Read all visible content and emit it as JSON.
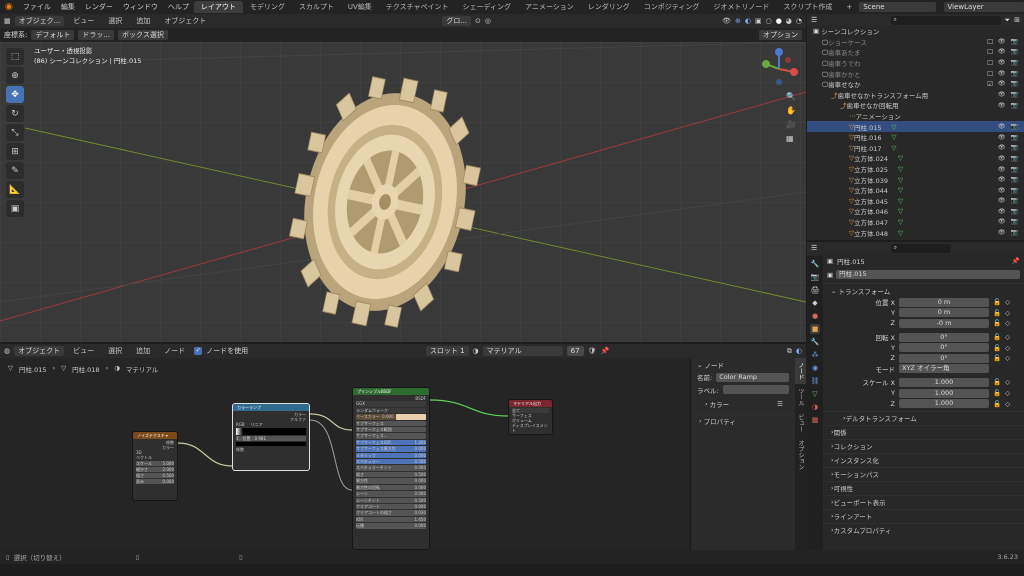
{
  "menubar": {
    "items": [
      "ファイル",
      "編集",
      "レンダー",
      "ウィンドウ",
      "ヘルプ"
    ],
    "workspaces": [
      "レイアウト",
      "モデリング",
      "スカルプト",
      "UV編集",
      "テクスチャペイント",
      "シェーディング",
      "アニメーション",
      "レンダリング",
      "コンポジティング",
      "ジオメトリノード",
      "スクリプト作成"
    ],
    "add_tab": "+",
    "scene": "Scene",
    "view_layer": "ViewLayer"
  },
  "viewport": {
    "mode": "オブジェク...",
    "menus": [
      "ビュー",
      "選択",
      "追加",
      "オブジェクト"
    ],
    "orientation_label": "座標系:",
    "orientation": "デフォルト",
    "drag": "ドラッ...",
    "select_mode": "ボックス選択",
    "pivot": "グロ...",
    "options": "オプション",
    "overlay_title": "ユーザー・透視投影",
    "overlay_sub": "(86) シーンコレクション | 円柱.015"
  },
  "node_editor": {
    "mode": "オブジェクト",
    "menus": [
      "ビュー",
      "選択",
      "追加",
      "ノード"
    ],
    "use_nodes": "ノードを使用",
    "slot": "スロット 1",
    "material": "マテリアル",
    "users": "67",
    "breadcrumb": [
      "円柱.015",
      "円柱.018",
      "マテリアル"
    ],
    "nodes": {
      "noise": {
        "title": "ノイズテクスチャ",
        "rows": [
          "係数",
          "カラー",
          "",
          "3D",
          "",
          "ベクトル",
          "スケール",
          "細かさ",
          "粗さ",
          "歪み"
        ],
        "values": [
          "5.000",
          "2.000",
          "0.500",
          "0.000"
        ]
      },
      "ramp": {
        "title": "カラーランプ",
        "out": [
          "カラー",
          "アルファ"
        ],
        "mode": "RGB",
        "interp": "リニア",
        "pos_index": "1",
        "pos_label": "位置",
        "pos_value": "0.981",
        "in": "係数"
      },
      "bsdf": {
        "title": "プリンシプルBSDF",
        "out": "BSDF",
        "dist": "GGX",
        "sss": "ランダムウォーク",
        "rows": [
          "ベースカラー",
          "サブサーフェス",
          "サブサーフェス範囲",
          "サブサーフェス...",
          "サブサーフェスIOR",
          "サブサーフェス異方性",
          "メタリック",
          "スペキュラー",
          "スペキュラーチント",
          "粗さ",
          "異方性",
          "異方性の回転",
          "シーン",
          "シーンチント",
          "クリアコート",
          "クリアコートの粗さ",
          "IOR",
          "伝播"
        ],
        "values": [
          "0.000",
          "",
          "",
          "",
          "1.400",
          "0.000",
          "0.000",
          "0.500",
          "0.000",
          "0.500",
          "0.000",
          "0.000",
          "0.000",
          "0.500",
          "0.000",
          "0.030",
          "1.450",
          "0.000"
        ]
      },
      "output": {
        "title": "マテリアル出力",
        "target": "全て",
        "rows": [
          "サーフェス",
          "ボリューム",
          "ディスプレイスメント"
        ]
      }
    }
  },
  "node_panel": {
    "section": "ノード",
    "name_label": "名前:",
    "name": "Color Ramp",
    "label_label": "ラベル:",
    "color": "カラー",
    "properties": "プロパティ",
    "tabs": [
      "ノード",
      "ツール",
      "ビュー",
      "オプション"
    ]
  },
  "outliner": {
    "root": "シーンコレクション",
    "items": [
      {
        "label": "ショーケース",
        "indent": 1
      },
      {
        "label": "歯車あたま",
        "indent": 1
      },
      {
        "label": "歯車うでわ",
        "indent": 1
      },
      {
        "label": "歯車かかと",
        "indent": 1
      },
      {
        "label": "歯車せなか",
        "indent": 1
      },
      {
        "label": "歯車せなかトランスフォーム用",
        "indent": 2
      },
      {
        "label": "歯車せなか回転用",
        "indent": 3
      },
      {
        "label": "アニメーション",
        "indent": 4
      },
      {
        "label": "円柱.015",
        "indent": 4
      },
      {
        "label": "円柱.016",
        "indent": 4
      },
      {
        "label": "円柱.017",
        "indent": 4
      },
      {
        "label": "立方体.024",
        "indent": 4
      },
      {
        "label": "立方体.025",
        "indent": 4
      },
      {
        "label": "立方体.039",
        "indent": 4
      },
      {
        "label": "立方体.044",
        "indent": 4
      },
      {
        "label": "立方体.045",
        "indent": 4
      },
      {
        "label": "立方体.046",
        "indent": 4
      },
      {
        "label": "立方体.047",
        "indent": 4
      },
      {
        "label": "立方体.048",
        "indent": 4
      }
    ]
  },
  "properties": {
    "object": "円柱.015",
    "object_name": "円柱.015",
    "transform": "トランスフォーム",
    "location_label": "位置 X",
    "loc": [
      "0 m",
      "0 m",
      "-0 m"
    ],
    "rotation_label": "回転 X",
    "rot": [
      "0°",
      "0°",
      "0°"
    ],
    "mode_label": "モード",
    "mode": "XYZ オイラー角",
    "scale_label": "スケール X",
    "scale": [
      "1.000",
      "1.000",
      "1.000"
    ],
    "axes": [
      "Y",
      "Z"
    ],
    "sections": [
      "デルタトランスフォーム",
      "関係",
      "コレクション",
      "インスタンス化",
      "モーションパス",
      "可視性",
      "ビューポート表示",
      "ラインアート",
      "カスタムプロパティ"
    ]
  },
  "status": {
    "select": "選択（切り替え）",
    "version": "3.6.23"
  }
}
